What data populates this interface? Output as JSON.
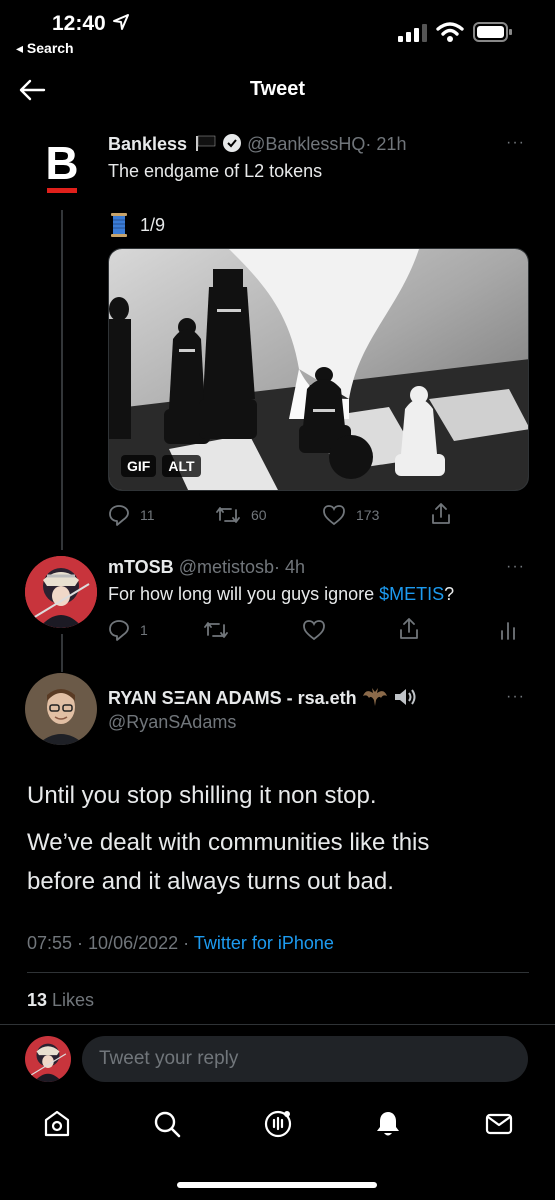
{
  "status_bar": {
    "time": "12:40",
    "back_app": "◂ Search"
  },
  "header": {
    "title": "Tweet"
  },
  "tweet1": {
    "name": "Bankless",
    "handle": "@BanklessHQ",
    "time": "· 21h",
    "text": "The endgame of L2 tokens",
    "thread_counter": "1/9",
    "media_badges": [
      "GIF",
      "ALT"
    ],
    "stats": {
      "replies": "11",
      "retweets": "60",
      "likes": "173"
    }
  },
  "tweet2": {
    "name": "mTOSB",
    "handle": "@metistosb",
    "time": "· 4h",
    "text_before": "For how long will you guys ignore ",
    "link": "$METIS",
    "text_after": "?",
    "stats": {
      "replies": "1"
    }
  },
  "main_tweet": {
    "name": "RYAN SΞAN ADAMS - rsa.eth",
    "handle": "@RyanSAdams",
    "line1": "Until you stop shilling it non stop.",
    "line2": "We’ve dealt with communities like this",
    "line3": "before and it always turns out bad.",
    "timestamp": "07:55 · 10/06/2022 · ",
    "source": "Twitter for iPhone",
    "likes_count": "13",
    "likes_label": " Likes"
  },
  "reply": {
    "placeholder": "Tweet your reply"
  },
  "colors": {
    "link": "#1d9bf0",
    "brand_red": "#e0201b",
    "background": "#000000"
  }
}
